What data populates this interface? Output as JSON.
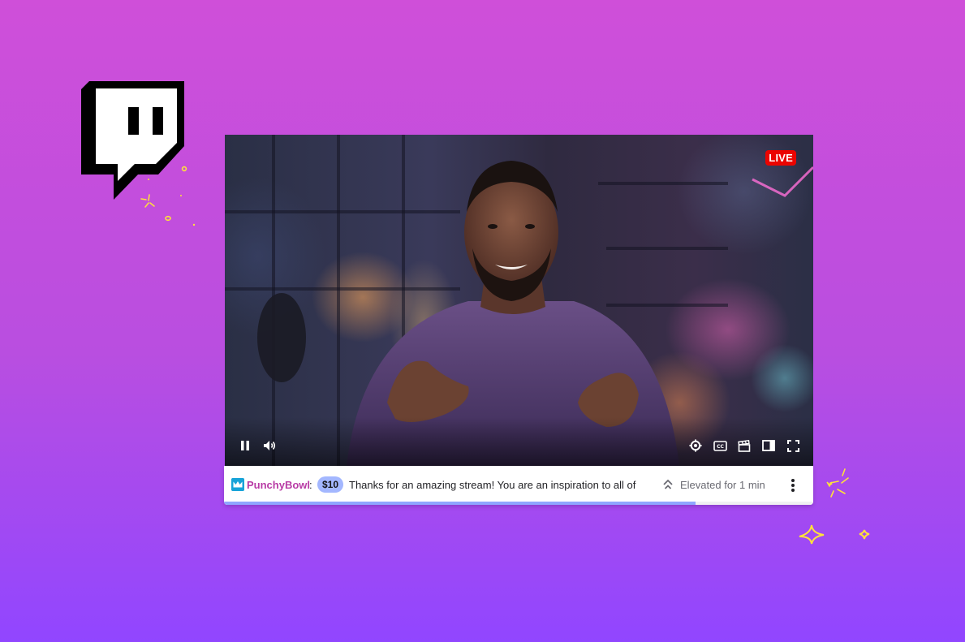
{
  "brand": {
    "logo_icon": "twitch-logo-icon",
    "accent": "#9146ff"
  },
  "player": {
    "live_label": "LIVE",
    "live_color": "#eb0400",
    "controls": {
      "pause_icon": "pause-icon",
      "volume_icon": "volume-icon",
      "settings_icon": "gear-icon",
      "captions_icon": "closed-captions-icon",
      "clip_icon": "clapperboard-icon",
      "theatre_icon": "theatre-mode-icon",
      "fullscreen_icon": "fullscreen-icon"
    }
  },
  "elevated_chat": {
    "username": "PunchyBowl",
    "username_color": "#b83ba5",
    "separator": ":",
    "amount": "$10",
    "message": "Thanks for an amazing stream! You are an inspiration to all of",
    "elevated_label": "Elevated for 1 min",
    "progress": 0.8,
    "more_icon": "more-vertical-icon"
  }
}
